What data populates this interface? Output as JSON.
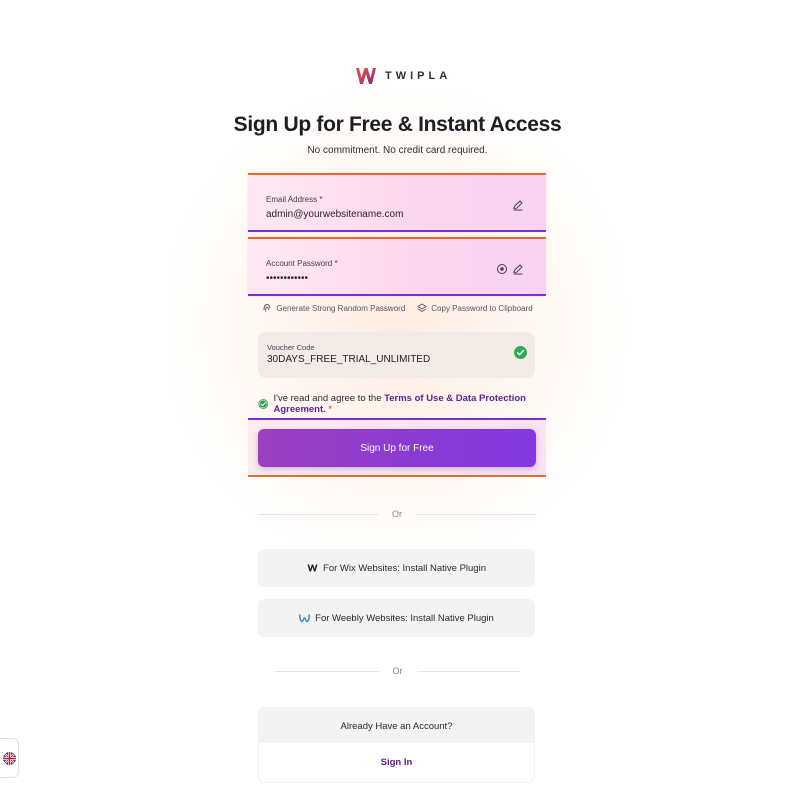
{
  "brand": {
    "name": "TWIPLA",
    "accent": "#8a3ad4",
    "accent_orange": "#e56b2c"
  },
  "header": {
    "title": "Sign Up for Free & Instant Access",
    "subtitle": "No commitment. No credit card required."
  },
  "form": {
    "email": {
      "label": "Email Address *",
      "value": "admin@yourwebsitename.com",
      "icon": "edit-icon"
    },
    "password": {
      "label": "Account Password *",
      "value": "••••••••••••",
      "icons": [
        "eye-icon",
        "edit-icon"
      ]
    },
    "helpers": {
      "generate_label": "Generate Strong Random Password",
      "copy_label": "Copy Password to Clipboard"
    },
    "voucher": {
      "label": "Voucher Code",
      "value": "30DAYS_FREE_TRIAL_UNLIMITED",
      "status": "valid"
    },
    "agreement": {
      "prefix": "I've read and agree to the",
      "link_text": "Terms of Use & Data Protection Agreement.",
      "required_mark": "*",
      "checked": true
    },
    "submit_label": "Sign Up for Free"
  },
  "divider_text": "Or",
  "plugins": {
    "wix_label": "For Wix Websites: Install Native Plugin",
    "weebly_label": "For Weebly Websites: Install Native Plugin"
  },
  "account": {
    "question": "Already Have an Account?",
    "signin_label": "Sign In"
  },
  "language": {
    "icon": "uk-flag-icon"
  }
}
